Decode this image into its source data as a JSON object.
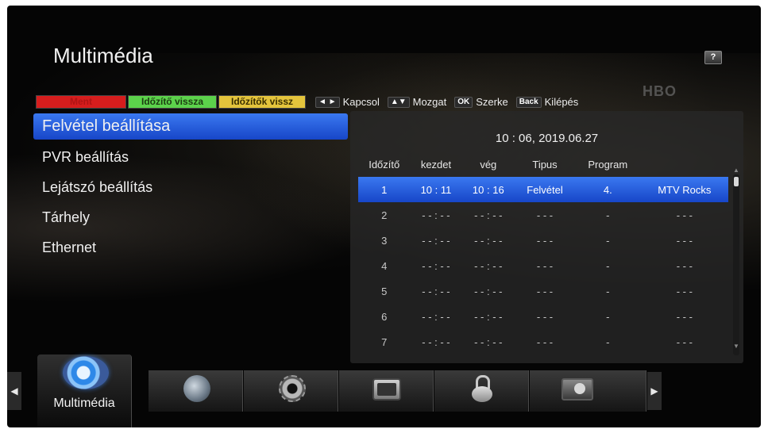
{
  "header": {
    "title": "Multimédia",
    "help_label": "?",
    "channel_logo": "HBO"
  },
  "function_keys": {
    "red": "Ment",
    "green": "Időzítő vissza",
    "yellow": "Időzítők vissz",
    "hints": [
      {
        "key": "◄ ►",
        "label": "Kapcsol"
      },
      {
        "key": "▲▼",
        "label": "Mozgat"
      },
      {
        "key": "OK",
        "label": "Szerke"
      },
      {
        "key": "Back",
        "label": "Kilépés"
      }
    ]
  },
  "menu": {
    "items": [
      {
        "label": "Felvétel beállítása",
        "selected": true
      },
      {
        "label": "PVR beállítás"
      },
      {
        "label": "Lejátszó beállítás"
      },
      {
        "label": "Tárhely"
      },
      {
        "label": "Ethernet"
      }
    ]
  },
  "timers": {
    "clock": "10 : 06, 2019.06.27",
    "columns": [
      "Időzítő",
      "kezdet",
      "vég",
      "Tipus",
      "Program",
      ""
    ],
    "rows": [
      {
        "n": "1",
        "start": "10 : 11",
        "end": "10 : 16",
        "type": "Felvétel",
        "prog": "4.",
        "name": "MTV Rocks",
        "selected": true
      },
      {
        "n": "2",
        "start": "- - : - -",
        "end": "- - : - -",
        "type": "- - -",
        "prog": "-",
        "name": "- - -"
      },
      {
        "n": "3",
        "start": "- - : - -",
        "end": "- - : - -",
        "type": "- - -",
        "prog": "-",
        "name": "- - -"
      },
      {
        "n": "4",
        "start": "- - : - -",
        "end": "- - : - -",
        "type": "- - -",
        "prog": "-",
        "name": "- - -"
      },
      {
        "n": "5",
        "start": "- - : - -",
        "end": "- - : - -",
        "type": "- - -",
        "prog": "-",
        "name": "- - -"
      },
      {
        "n": "6",
        "start": "- - : - -",
        "end": "- - : - -",
        "type": "- - -",
        "prog": "-",
        "name": "- - -"
      },
      {
        "n": "7",
        "start": "- - : - -",
        "end": "- - : - -",
        "type": "- - -",
        "prog": "-",
        "name": "- - -"
      }
    ]
  },
  "nav": {
    "active_label": "Multimédia",
    "tabs": [
      "multimedia-icon",
      "globe-icon",
      "gear-icon",
      "tv-icon",
      "lock-icon",
      "film-icon"
    ]
  }
}
